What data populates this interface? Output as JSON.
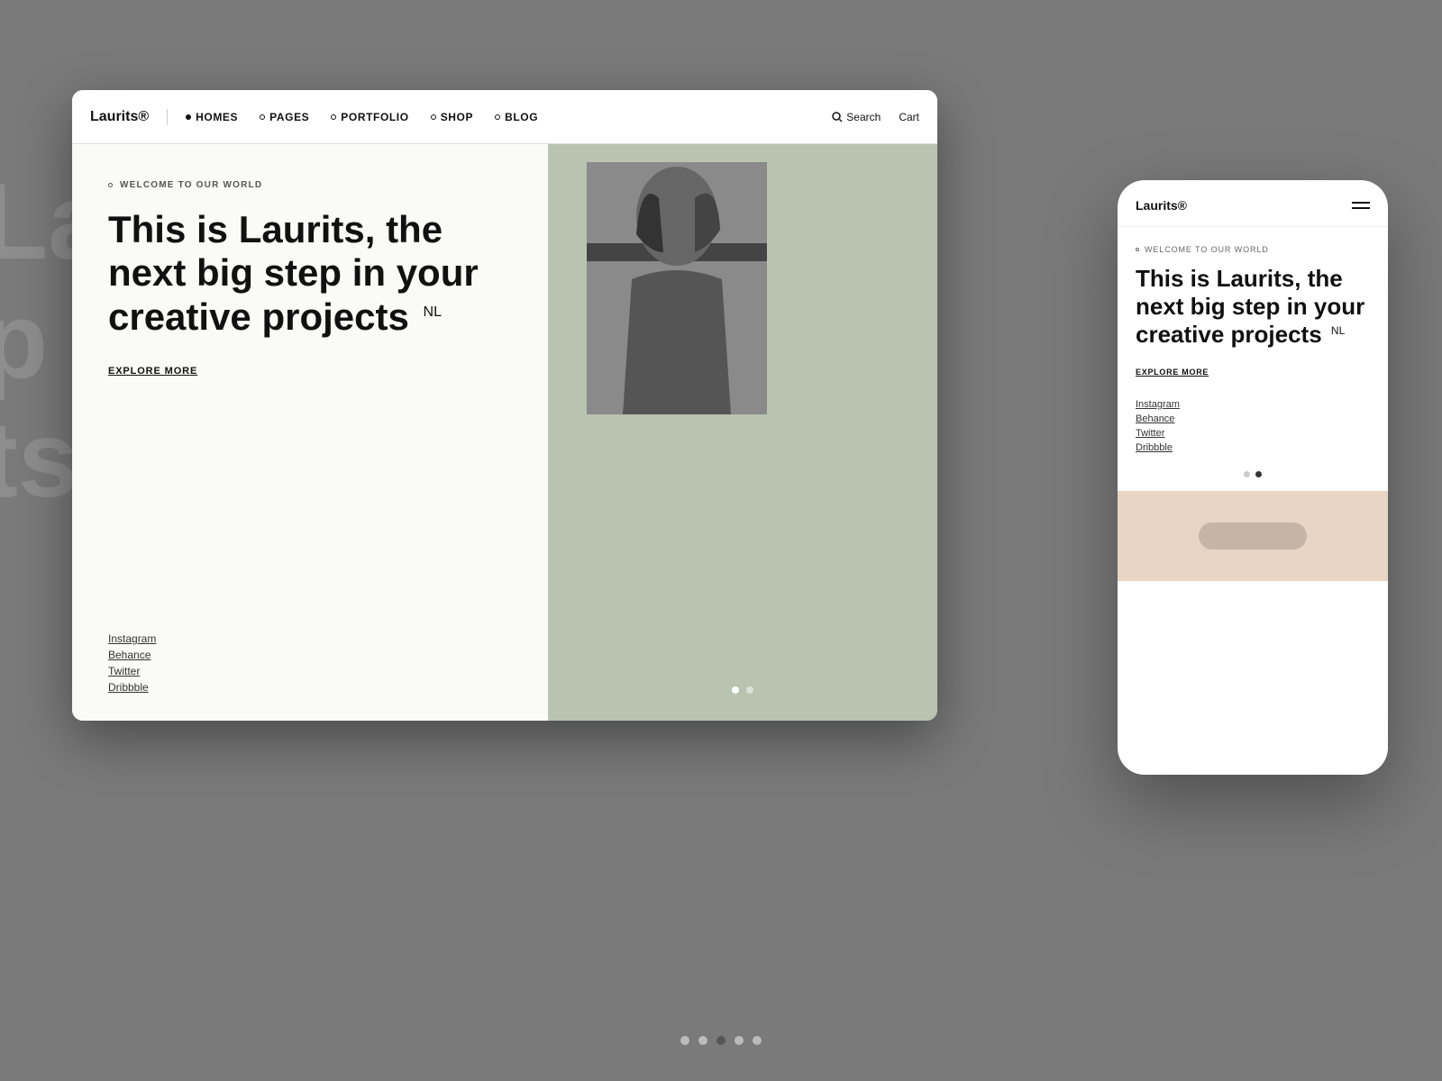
{
  "background": {
    "bg_text": "Lau\np i\nts N"
  },
  "browser": {
    "nav": {
      "logo": "Laurits®",
      "links": [
        {
          "label": "HOMES",
          "dot": "filled"
        },
        {
          "label": "PAGES",
          "dot": "outline"
        },
        {
          "label": "PORTFOLIO",
          "dot": "outline"
        },
        {
          "label": "SHOP",
          "dot": "outline"
        },
        {
          "label": "BLOG",
          "dot": "outline"
        }
      ],
      "search_label": "Search",
      "cart_label": "Cart"
    },
    "left": {
      "welcome_text": "WELCOME TO OUR WORLD",
      "hero_title": "This is Laurits, the next big step in your creative projects",
      "hero_title_badge": "NL",
      "explore_label": "EXPLORE MORE",
      "social_links": [
        {
          "label": "Instagram"
        },
        {
          "label": "Behance"
        },
        {
          "label": "Twitter"
        },
        {
          "label": "Dribbble"
        }
      ]
    },
    "right": {
      "slide_dots": [
        {
          "active": true
        },
        {
          "active": false
        }
      ]
    }
  },
  "phone": {
    "nav": {
      "logo": "Laurits®"
    },
    "content": {
      "welcome_text": "WELCOME TO OUR WORLD",
      "hero_title": "This is Laurits, the next big step in your creative projects",
      "hero_title_badge": "NL",
      "explore_label": "EXPLORE MORE",
      "social_links": [
        {
          "label": "Instagram"
        },
        {
          "label": "Behance"
        },
        {
          "label": "Twitter"
        },
        {
          "label": "Dribbble"
        }
      ],
      "dots": [
        {
          "active": false
        },
        {
          "active": true
        }
      ]
    }
  },
  "bottom_dots": [
    {
      "active": false
    },
    {
      "active": false
    },
    {
      "active": true
    },
    {
      "active": false
    },
    {
      "active": false
    }
  ]
}
